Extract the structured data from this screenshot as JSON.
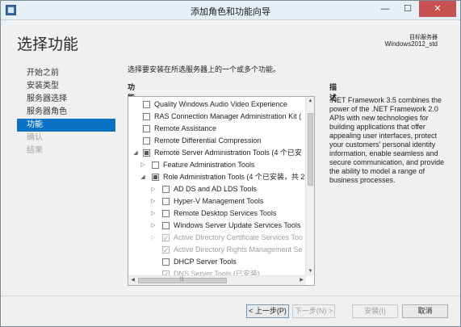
{
  "window": {
    "title": "添加角色和功能向导",
    "controls": {
      "minimize": "—",
      "maximize": "☐",
      "close": "✕"
    }
  },
  "header": {
    "page_title": "选择功能",
    "target_label": "目标服务器",
    "target_name": "Windows2012_std"
  },
  "nav": {
    "items": [
      {
        "label": "开始之前"
      },
      {
        "label": "安装类型"
      },
      {
        "label": "服务器选择"
      },
      {
        "label": "服务器角色"
      },
      {
        "label": "功能"
      },
      {
        "label": "确认"
      },
      {
        "label": "结果"
      }
    ]
  },
  "content": {
    "instruction": "选择要安装在所选服务器上的一个或多个功能。",
    "features_heading": "功能",
    "description_heading": "描述",
    "description_text": ".NET Framework 3.5 combines the power of the .NET Framework 2.0 APIs with new technologies for building applications that offer appealing user interfaces, protect your customers' personal identity information, enable seamless and secure communication, and provide the ability to model a range of business processes."
  },
  "tree": {
    "rows": [
      {
        "label": "Quality Windows Audio Video Experience",
        "state": "unchecked"
      },
      {
        "label": "RAS Connection Manager Administration Kit (",
        "state": "unchecked"
      },
      {
        "label": "Remote Assistance",
        "state": "unchecked"
      },
      {
        "label": "Remote Differential Compression",
        "state": "unchecked"
      },
      {
        "label": "Remote Server Administration Tools (4 个已安",
        "state": "partial"
      },
      {
        "label": "Feature Administration Tools",
        "state": "unchecked"
      },
      {
        "label": "Role Administration Tools (4 个已安装，共 2",
        "state": "partial"
      },
      {
        "label": "AD DS and AD LDS Tools",
        "state": "unchecked"
      },
      {
        "label": "Hyper-V Management Tools",
        "state": "unchecked"
      },
      {
        "label": "Remote Desktop Services Tools",
        "state": "unchecked"
      },
      {
        "label": "Windows Server Update Services Tools",
        "state": "unchecked"
      },
      {
        "label": "Active Directory Certificate Services Too",
        "state": "checked"
      },
      {
        "label": "Active Directory Rights Management Se",
        "state": "checked"
      },
      {
        "label": "DHCP Server Tools",
        "state": "unchecked"
      },
      {
        "label": "DNS Server Tools (已安装)",
        "state": "checked"
      }
    ]
  },
  "buttons": {
    "prev": "< 上一步(P)",
    "next": "下一步(N) >",
    "install": "安装(I)",
    "cancel": "取消"
  }
}
